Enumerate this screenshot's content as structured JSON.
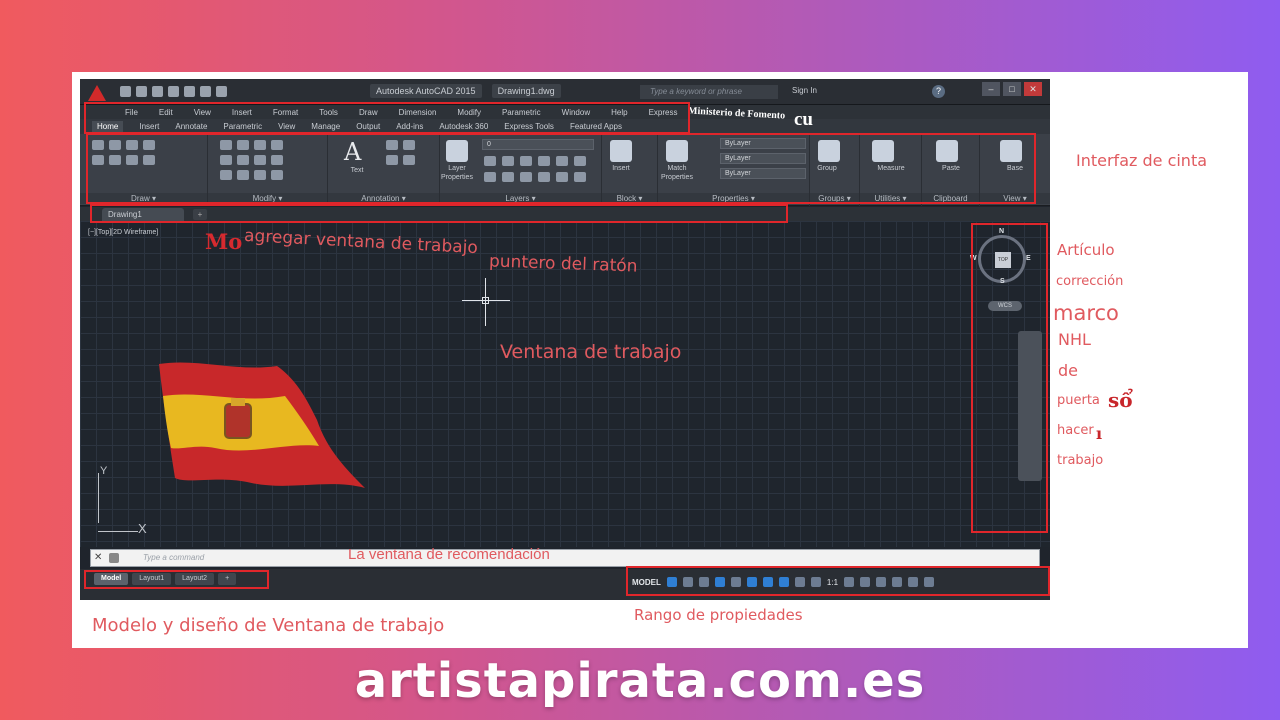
{
  "app": {
    "window_title": "Autodesk AutoCAD 2015",
    "file_title": "Drawing1.dwg",
    "search_placeholder": "Type a keyword or phrase",
    "sign_in": "Sign In",
    "help": "?"
  },
  "menubar": [
    "File",
    "Edit",
    "View",
    "Insert",
    "Format",
    "Tools",
    "Draw",
    "Dimension",
    "Modify",
    "Parametric",
    "Window",
    "Help",
    "Express"
  ],
  "ribbon_tabs": [
    "Home",
    "Insert",
    "Annotate",
    "Parametric",
    "View",
    "Manage",
    "Output",
    "Add-ins",
    "Autodesk 360",
    "Express Tools",
    "Featured Apps"
  ],
  "ribbon": {
    "panels": {
      "draw": "Draw ▾",
      "modify": "Modify ▾",
      "annotation": "Annotation ▾",
      "layers": "Layers ▾",
      "block": "Block ▾",
      "properties": "Properties ▾",
      "groups": "Groups ▾",
      "utilities": "Utilities ▾",
      "clipboard": "Clipboard",
      "view": "View ▾"
    },
    "tools": {
      "text": "Text",
      "layer_properties": "Layer\nProperties",
      "insert": "Insert",
      "match_properties": "Match\nProperties",
      "group": "Group",
      "measure": "Measure",
      "paste": "Paste",
      "base": "Base"
    },
    "layer_value": "0",
    "bylayer": "ByLayer"
  },
  "file_tab": "Drawing1",
  "view_label": "[−][Top][2D Wireframe]",
  "viewcube": {
    "n": "N",
    "s": "S",
    "e": "E",
    "w": "W",
    "top": "TOP",
    "wcs": "WCS"
  },
  "ucs": {
    "x": "X",
    "y": "Y"
  },
  "command_placeholder": "Type a command",
  "layout_tabs": [
    "Model",
    "Layout1",
    "Layout2",
    "+"
  ],
  "status": {
    "model": "MODEL",
    "scale": "1:1"
  },
  "overlay": {
    "ministerio": "Ministerio de Fomento",
    "cu": "cu",
    "mo": "Mo",
    "agregar": "agregar ventana de trabajo",
    "puntero": "puntero del ratón",
    "ventana": "Ventana de trabajo",
    "interfaz": "Interfaz de cinta",
    "recomendacion": "La ventana de recomendación",
    "rango": "Rango de propiedades",
    "modelo": "Modelo y diseño de Ventana de trabajo",
    "side": [
      "Artículo",
      "corrección",
      "marco",
      "NHL",
      "de",
      "puerta",
      "sổ",
      "hacer",
      "ı",
      "trabajo"
    ]
  },
  "footer": "artistapirata.com.es",
  "colors": {
    "frame": "#e0262b",
    "annotation": "#e05a5f",
    "flag_red": "#c8282a",
    "flag_yellow": "#e8b820"
  }
}
